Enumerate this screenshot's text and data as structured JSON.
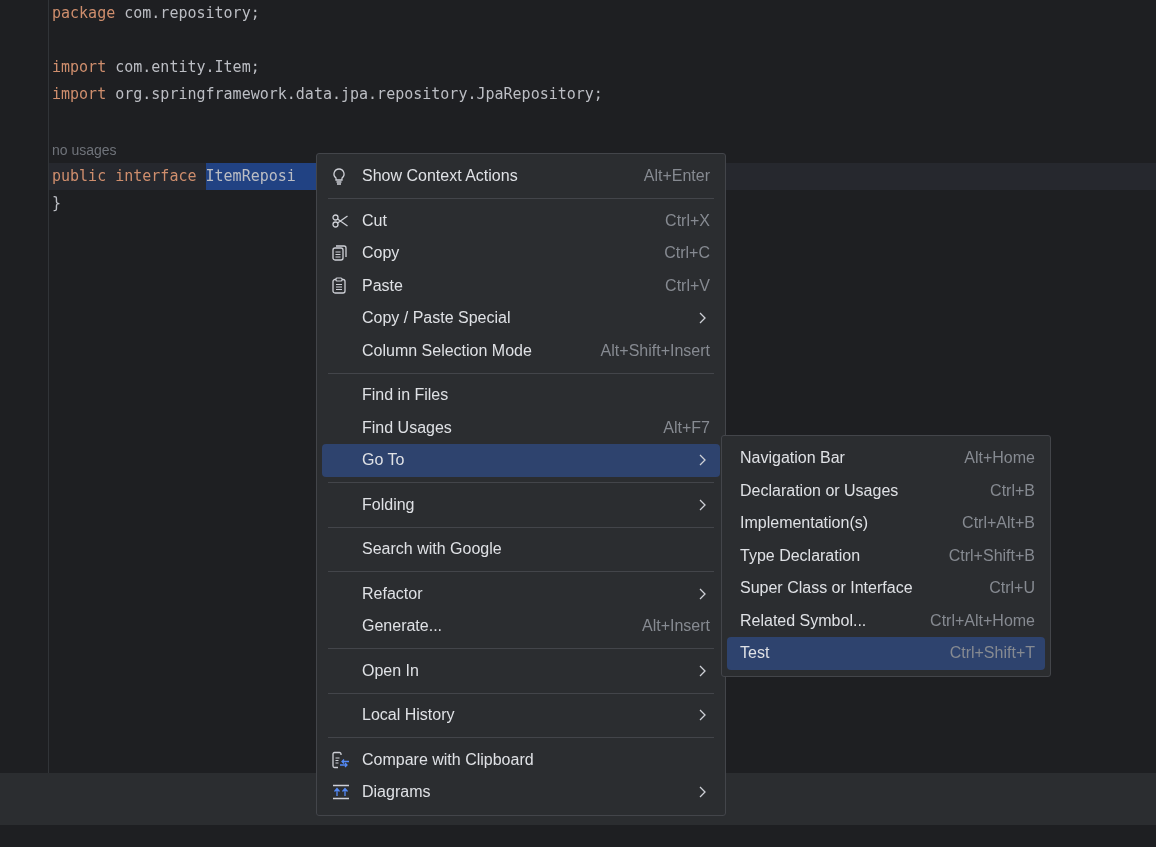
{
  "editor": {
    "lines": [
      {
        "kind": "code",
        "current": false,
        "tokens": [
          {
            "kind": "keyword",
            "text": "package "
          },
          {
            "kind": "plain",
            "text": "com.repository;"
          }
        ]
      },
      {
        "kind": "code",
        "current": false
      },
      {
        "kind": "code",
        "current": false,
        "tokens": [
          {
            "kind": "keyword",
            "text": "import "
          },
          {
            "kind": "plain",
            "text": "com.entity.Item;"
          }
        ]
      },
      {
        "kind": "code",
        "current": false,
        "tokens": [
          {
            "kind": "keyword",
            "text": "import "
          },
          {
            "kind": "plain",
            "text": "org.springframework.data.jpa.repository.JpaRepository;"
          }
        ]
      },
      {
        "kind": "code",
        "current": false
      },
      {
        "kind": "hint",
        "text": "no usages"
      },
      {
        "kind": "code",
        "current": true,
        "tokens": [
          {
            "kind": "keyword",
            "text": "public interface "
          },
          {
            "kind": "selected",
            "text": "ItemReposi"
          }
        ]
      },
      {
        "kind": "code",
        "current": false,
        "tokens": [
          {
            "kind": "plain",
            "text": "}"
          }
        ]
      },
      {
        "kind": "code",
        "current": false
      }
    ]
  },
  "context_menu": [
    {
      "kind": "lightbulb",
      "label": "Show Context Actions",
      "shortcut": "Alt+Enter",
      "submenu": false,
      "selected": false
    },
    {
      "kind": "separator"
    },
    {
      "kind": "scissors",
      "label": "Cut",
      "shortcut": "Ctrl+X",
      "submenu": false,
      "selected": false
    },
    {
      "kind": "copy",
      "label": "Copy",
      "shortcut": "Ctrl+C",
      "submenu": false,
      "selected": false
    },
    {
      "kind": "paste",
      "label": "Paste",
      "shortcut": "Ctrl+V",
      "submenu": false,
      "selected": false
    },
    {
      "kind": "plain",
      "label": "Copy / Paste Special",
      "submenu": true,
      "selected": false
    },
    {
      "kind": "plain",
      "label": "Column Selection Mode",
      "shortcut": "Alt+Shift+Insert",
      "submenu": false,
      "selected": false
    },
    {
      "kind": "separator"
    },
    {
      "kind": "plain",
      "label": "Find in Files",
      "submenu": false,
      "selected": false
    },
    {
      "kind": "plain",
      "label": "Find Usages",
      "shortcut": "Alt+F7",
      "submenu": false,
      "selected": false
    },
    {
      "kind": "plain",
      "label": "Go To",
      "submenu": true,
      "selected": true
    },
    {
      "kind": "separator"
    },
    {
      "kind": "plain",
      "label": "Folding",
      "submenu": true,
      "selected": false
    },
    {
      "kind": "separator"
    },
    {
      "kind": "plain",
      "label": "Search with Google",
      "submenu": false,
      "selected": false
    },
    {
      "kind": "separator"
    },
    {
      "kind": "plain",
      "label": "Refactor",
      "submenu": true,
      "selected": false
    },
    {
      "kind": "plain",
      "label": "Generate...",
      "shortcut": "Alt+Insert",
      "submenu": false,
      "selected": false
    },
    {
      "kind": "separator"
    },
    {
      "kind": "plain",
      "label": "Open In",
      "submenu": true,
      "selected": false
    },
    {
      "kind": "separator"
    },
    {
      "kind": "plain",
      "label": "Local History",
      "submenu": true,
      "selected": false
    },
    {
      "kind": "separator"
    },
    {
      "kind": "compare",
      "label": "Compare with Clipboard",
      "submenu": false,
      "selected": false
    },
    {
      "kind": "diagrams",
      "label": "Diagrams",
      "submenu": true,
      "selected": false
    }
  ],
  "submenu": [
    {
      "label": "Navigation Bar",
      "shortcut": "Alt+Home",
      "selected": false
    },
    {
      "label": "Declaration or Usages",
      "shortcut": "Ctrl+B",
      "selected": false
    },
    {
      "label": "Implementation(s)",
      "shortcut": "Ctrl+Alt+B",
      "selected": false
    },
    {
      "label": "Type Declaration",
      "shortcut": "Ctrl+Shift+B",
      "selected": false
    },
    {
      "label": "Super Class or Interface",
      "shortcut": "Ctrl+U",
      "selected": false
    },
    {
      "label": "Related Symbol...",
      "shortcut": "Ctrl+Alt+Home",
      "selected": false
    },
    {
      "label": "Test",
      "shortcut": "Ctrl+Shift+T",
      "selected": true
    }
  ]
}
